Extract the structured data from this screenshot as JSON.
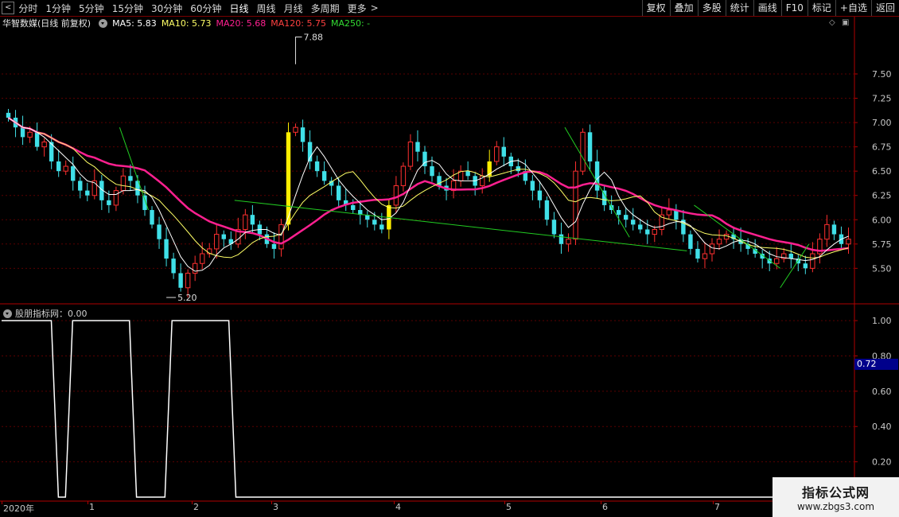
{
  "toolbar": {
    "first_icon": "back-icon",
    "periods": [
      "分时",
      "1分钟",
      "5分钟",
      "15分钟",
      "30分钟",
      "60分钟",
      "日线",
      "周线",
      "月线",
      "多周期",
      "更多"
    ],
    "active_period": "日线",
    "more_arrow": ">",
    "right_buttons": [
      "复权",
      "叠加",
      "多股",
      "统计",
      "画线",
      "F10",
      "标记",
      "+自选",
      "返回"
    ]
  },
  "ma_bar": {
    "title": "华智数媒(日线 前复权)",
    "ma5": "MA5: 5.83",
    "ma10": "MA10: 5.73",
    "ma20": "MA20: 5.68",
    "ma120": "MA120: 5.75",
    "ma250": "MA250: -"
  },
  "indicator": {
    "title": "股朋指标网：0.00",
    "cursor_value": "0.72"
  },
  "date_axis": {
    "labels": [
      "2020年",
      "1",
      "2",
      "3",
      "4",
      "5",
      "6",
      "7"
    ]
  },
  "watermark": {
    "title": "指标公式网",
    "url": "www.zbgs3.com"
  },
  "colors": {
    "up": "#ff3030",
    "down": "#40e0e8",
    "ma5": "#ffffff",
    "ma10": "#ffff66",
    "ma20": "#ff2090",
    "ma120": "#ff4040",
    "ma250": "#33dd33",
    "highlight": "#ffee00",
    "trend_line": "#22cc22",
    "axis_red": "#b00000"
  },
  "chart_data": [
    {
      "type": "candlestick",
      "title": "华智数媒(日线 前复权)",
      "y_ticks": [
        5.5,
        5.75,
        6.0,
        6.25,
        6.5,
        6.75,
        7.0,
        7.25,
        7.5
      ],
      "y_tick_labels": [
        "5.50",
        "5.75",
        "6.00",
        "6.25",
        "6.50",
        "6.75",
        "7.00",
        "7.25",
        "7.50"
      ],
      "ylim": [
        5.2,
        7.95
      ],
      "annotations": [
        {
          "text": "7.88",
          "value": 7.88
        },
        {
          "text": "5.20",
          "value": 5.2
        }
      ],
      "series": [
        {
          "name": "MA5",
          "approx_last": 5.83
        },
        {
          "name": "MA10",
          "approx_last": 5.73
        },
        {
          "name": "MA20",
          "approx_last": 5.68
        },
        {
          "name": "MA120",
          "approx_last": 5.75
        }
      ],
      "close_approx": [
        7.05,
        6.95,
        6.85,
        6.9,
        6.75,
        6.8,
        6.6,
        6.5,
        6.55,
        6.4,
        6.3,
        6.25,
        6.4,
        6.2,
        6.15,
        6.3,
        6.45,
        6.4,
        6.25,
        6.1,
        5.95,
        5.8,
        5.6,
        5.45,
        5.3,
        5.45,
        5.55,
        5.65,
        5.7,
        5.85,
        5.8,
        5.75,
        5.9,
        6.05,
        5.95,
        5.85,
        5.75,
        5.7,
        5.95,
        6.9,
        6.95,
        6.8,
        6.6,
        6.5,
        6.4,
        6.35,
        6.2,
        6.15,
        6.1,
        6.05,
        6.0,
        5.95,
        5.9,
        6.15,
        6.35,
        6.55,
        6.8,
        6.7,
        6.55,
        6.45,
        6.35,
        6.3,
        6.4,
        6.5,
        6.45,
        6.35,
        6.45,
        6.6,
        6.75,
        6.65,
        6.55,
        6.5,
        6.4,
        6.3,
        6.2,
        6.0,
        5.85,
        5.75,
        5.8,
        6.5,
        6.9,
        6.6,
        6.3,
        6.15,
        6.1,
        6.05,
        6.0,
        5.95,
        5.9,
        5.85,
        5.9,
        6.05,
        6.1,
        6.0,
        5.85,
        5.7,
        5.6,
        5.65,
        5.75,
        5.8,
        5.85,
        5.8,
        5.75,
        5.7,
        5.65,
        5.6,
        5.55,
        5.6,
        5.65,
        5.6,
        5.55,
        5.5,
        5.65,
        5.8,
        5.95,
        5.85,
        5.75,
        5.8
      ]
    },
    {
      "type": "line",
      "title": "股朋指标网",
      "y_ticks": [
        0.2,
        0.4,
        0.6,
        0.8,
        1.0
      ],
      "y_tick_labels": [
        "0.20",
        "0.40",
        "0.60",
        "0.80",
        "1.00"
      ],
      "ylim": [
        0,
        1.05
      ],
      "values": [
        1,
        1,
        1,
        1,
        1,
        1,
        1,
        1,
        0,
        0,
        1,
        1,
        1,
        1,
        1,
        1,
        1,
        1,
        1,
        0,
        0,
        0,
        0,
        0,
        1,
        1,
        1,
        1,
        1,
        1,
        1,
        1,
        1,
        0,
        0,
        0,
        0,
        0,
        0,
        0,
        0,
        0,
        0,
        0,
        0,
        0,
        0,
        0,
        0,
        0,
        0,
        0,
        0,
        0,
        0,
        0,
        0,
        0,
        0,
        0,
        0,
        0,
        0,
        0,
        0,
        0,
        0,
        0,
        0,
        0,
        0,
        0,
        0,
        0,
        0,
        0,
        0,
        0,
        0,
        0,
        0,
        0,
        0,
        0,
        0,
        0,
        0,
        0,
        0,
        0,
        0,
        0,
        0,
        0,
        0,
        0,
        0,
        0,
        0,
        0,
        0,
        0,
        0,
        0,
        0,
        0,
        0,
        0,
        0,
        0,
        0,
        0,
        0,
        0,
        0,
        0,
        0,
        0,
        0,
        0
      ]
    }
  ]
}
